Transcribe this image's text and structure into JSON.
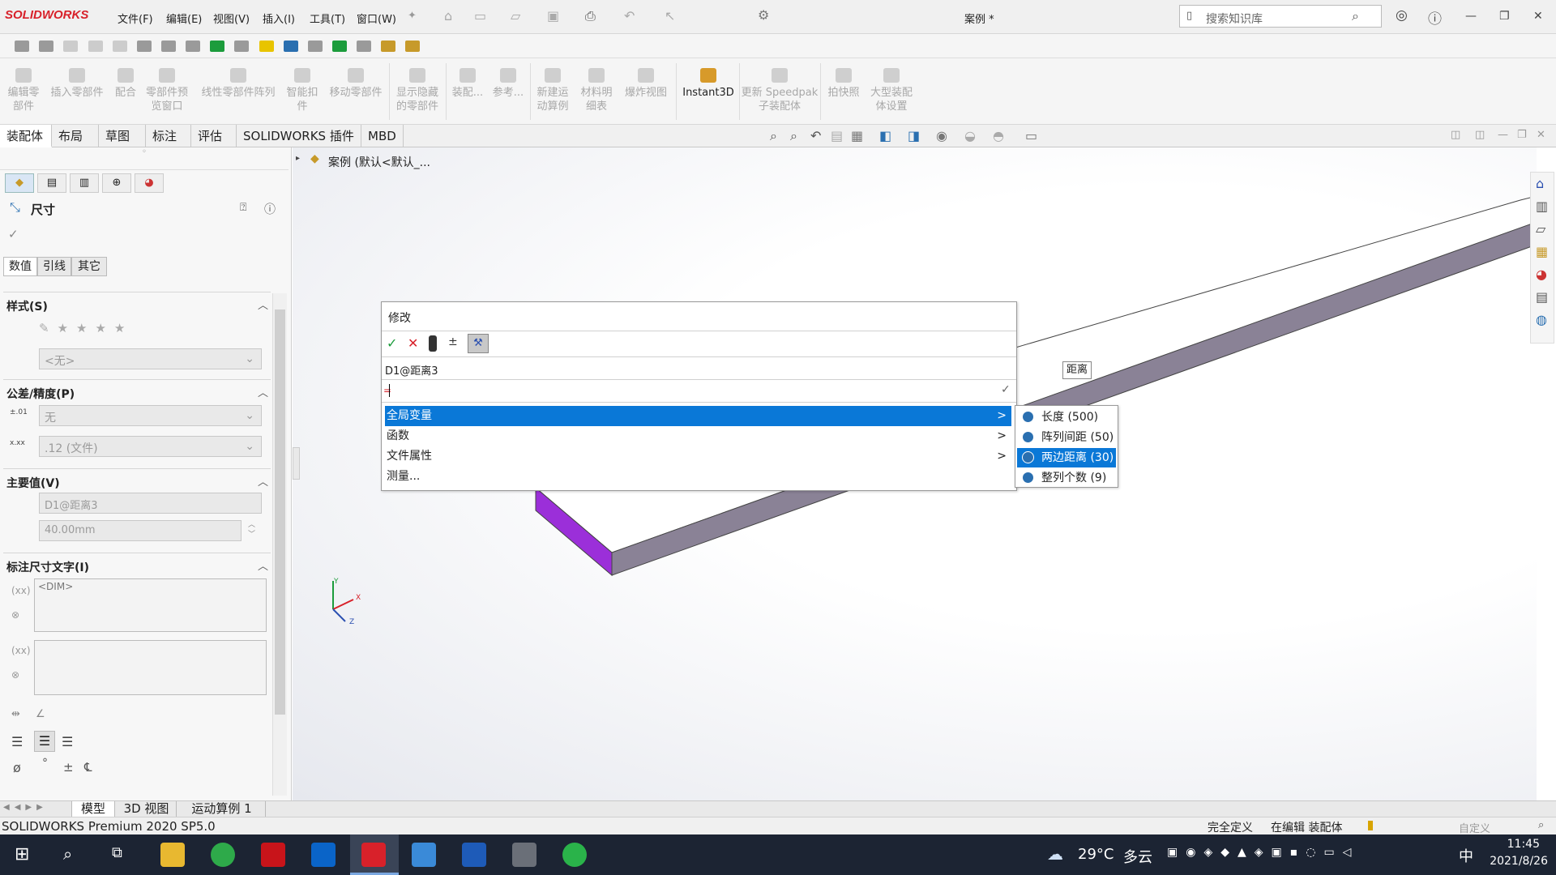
{
  "app": {
    "logo": "SOLIDWORKS",
    "doc_title": "案例 *"
  },
  "menu": [
    "文件(F)",
    "编辑(E)",
    "视图(V)",
    "插入(I)",
    "工具(T)",
    "窗口(W)"
  ],
  "search": {
    "placeholder": "搜索知识库"
  },
  "ribbon": {
    "items": [
      {
        "label": "编辑零\n部件"
      },
      {
        "label": "插入零部件"
      },
      {
        "label": "配合"
      },
      {
        "label": "零部件预\n览窗口"
      },
      {
        "label": "线性零部件阵列"
      },
      {
        "label": "智能扣\n件"
      },
      {
        "label": "移动零部件"
      },
      {
        "label": "显示隐藏\n的零部件"
      },
      {
        "label": "装配..."
      },
      {
        "label": "参考..."
      },
      {
        "label": "新建运\n动算例"
      },
      {
        "label": "材料明\n细表"
      },
      {
        "label": "爆炸视图"
      },
      {
        "label": "Instant3D"
      },
      {
        "label": "更新 Speedpak\n子装配体"
      },
      {
        "label": "拍快照"
      },
      {
        "label": "大型装配\n体设置"
      }
    ]
  },
  "tabs": [
    "装配体",
    "布局",
    "草图",
    "标注",
    "评估",
    "SOLIDWORKS 插件",
    "MBD"
  ],
  "tree": {
    "root": "案例  (默认<默认_..."
  },
  "property": {
    "title": "尺寸",
    "subtabs": [
      "数值",
      "引线",
      "其它"
    ],
    "style_header": "样式(S)",
    "style_value": "<无>",
    "tolerance_header": "公差/精度(P)",
    "tolerance_value": "无",
    "precision_value": ".12 (文件)",
    "primary_header": "主要值(V)",
    "primary_name": "D1@距离3",
    "primary_value": "40.00mm",
    "dimtext_header": "标注尺寸文字(I)",
    "dimtext_value": "<DIM>"
  },
  "modify": {
    "title": "修改",
    "dim_name": "D1@距离3",
    "input_value": "=",
    "menu": [
      {
        "label": "全局变量",
        "arrow": ">"
      },
      {
        "label": "函数",
        "arrow": ">"
      },
      {
        "label": "文件属性",
        "arrow": ">"
      },
      {
        "label": "测量...",
        "arrow": ""
      }
    ],
    "submenu": [
      "长度 (500)",
      "阵列间距 (50)",
      "两边距离 (30)",
      "整列个数 (9)"
    ]
  },
  "viewport": {
    "distance_label": "距离",
    "axis_x": "X",
    "axis_y": "Y",
    "axis_z": "Z"
  },
  "bottom_tabs": [
    "模型",
    "3D 视图",
    "运动算例 1"
  ],
  "status": {
    "product": "SOLIDWORKS Premium 2020 SP5.0",
    "state1": "完全定义",
    "state2": "在编辑 装配体",
    "custom": "自定义"
  },
  "taskbar": {
    "weather_temp": "29°C",
    "weather_text": "多云",
    "ime": "中",
    "time": "11:45",
    "date": "2021/8/26"
  },
  "colors": {
    "selection": "#0a78d7",
    "purple_edge": "#9b2fd9",
    "plate_side": "#8a8296",
    "taskbar": "#1c2433"
  }
}
